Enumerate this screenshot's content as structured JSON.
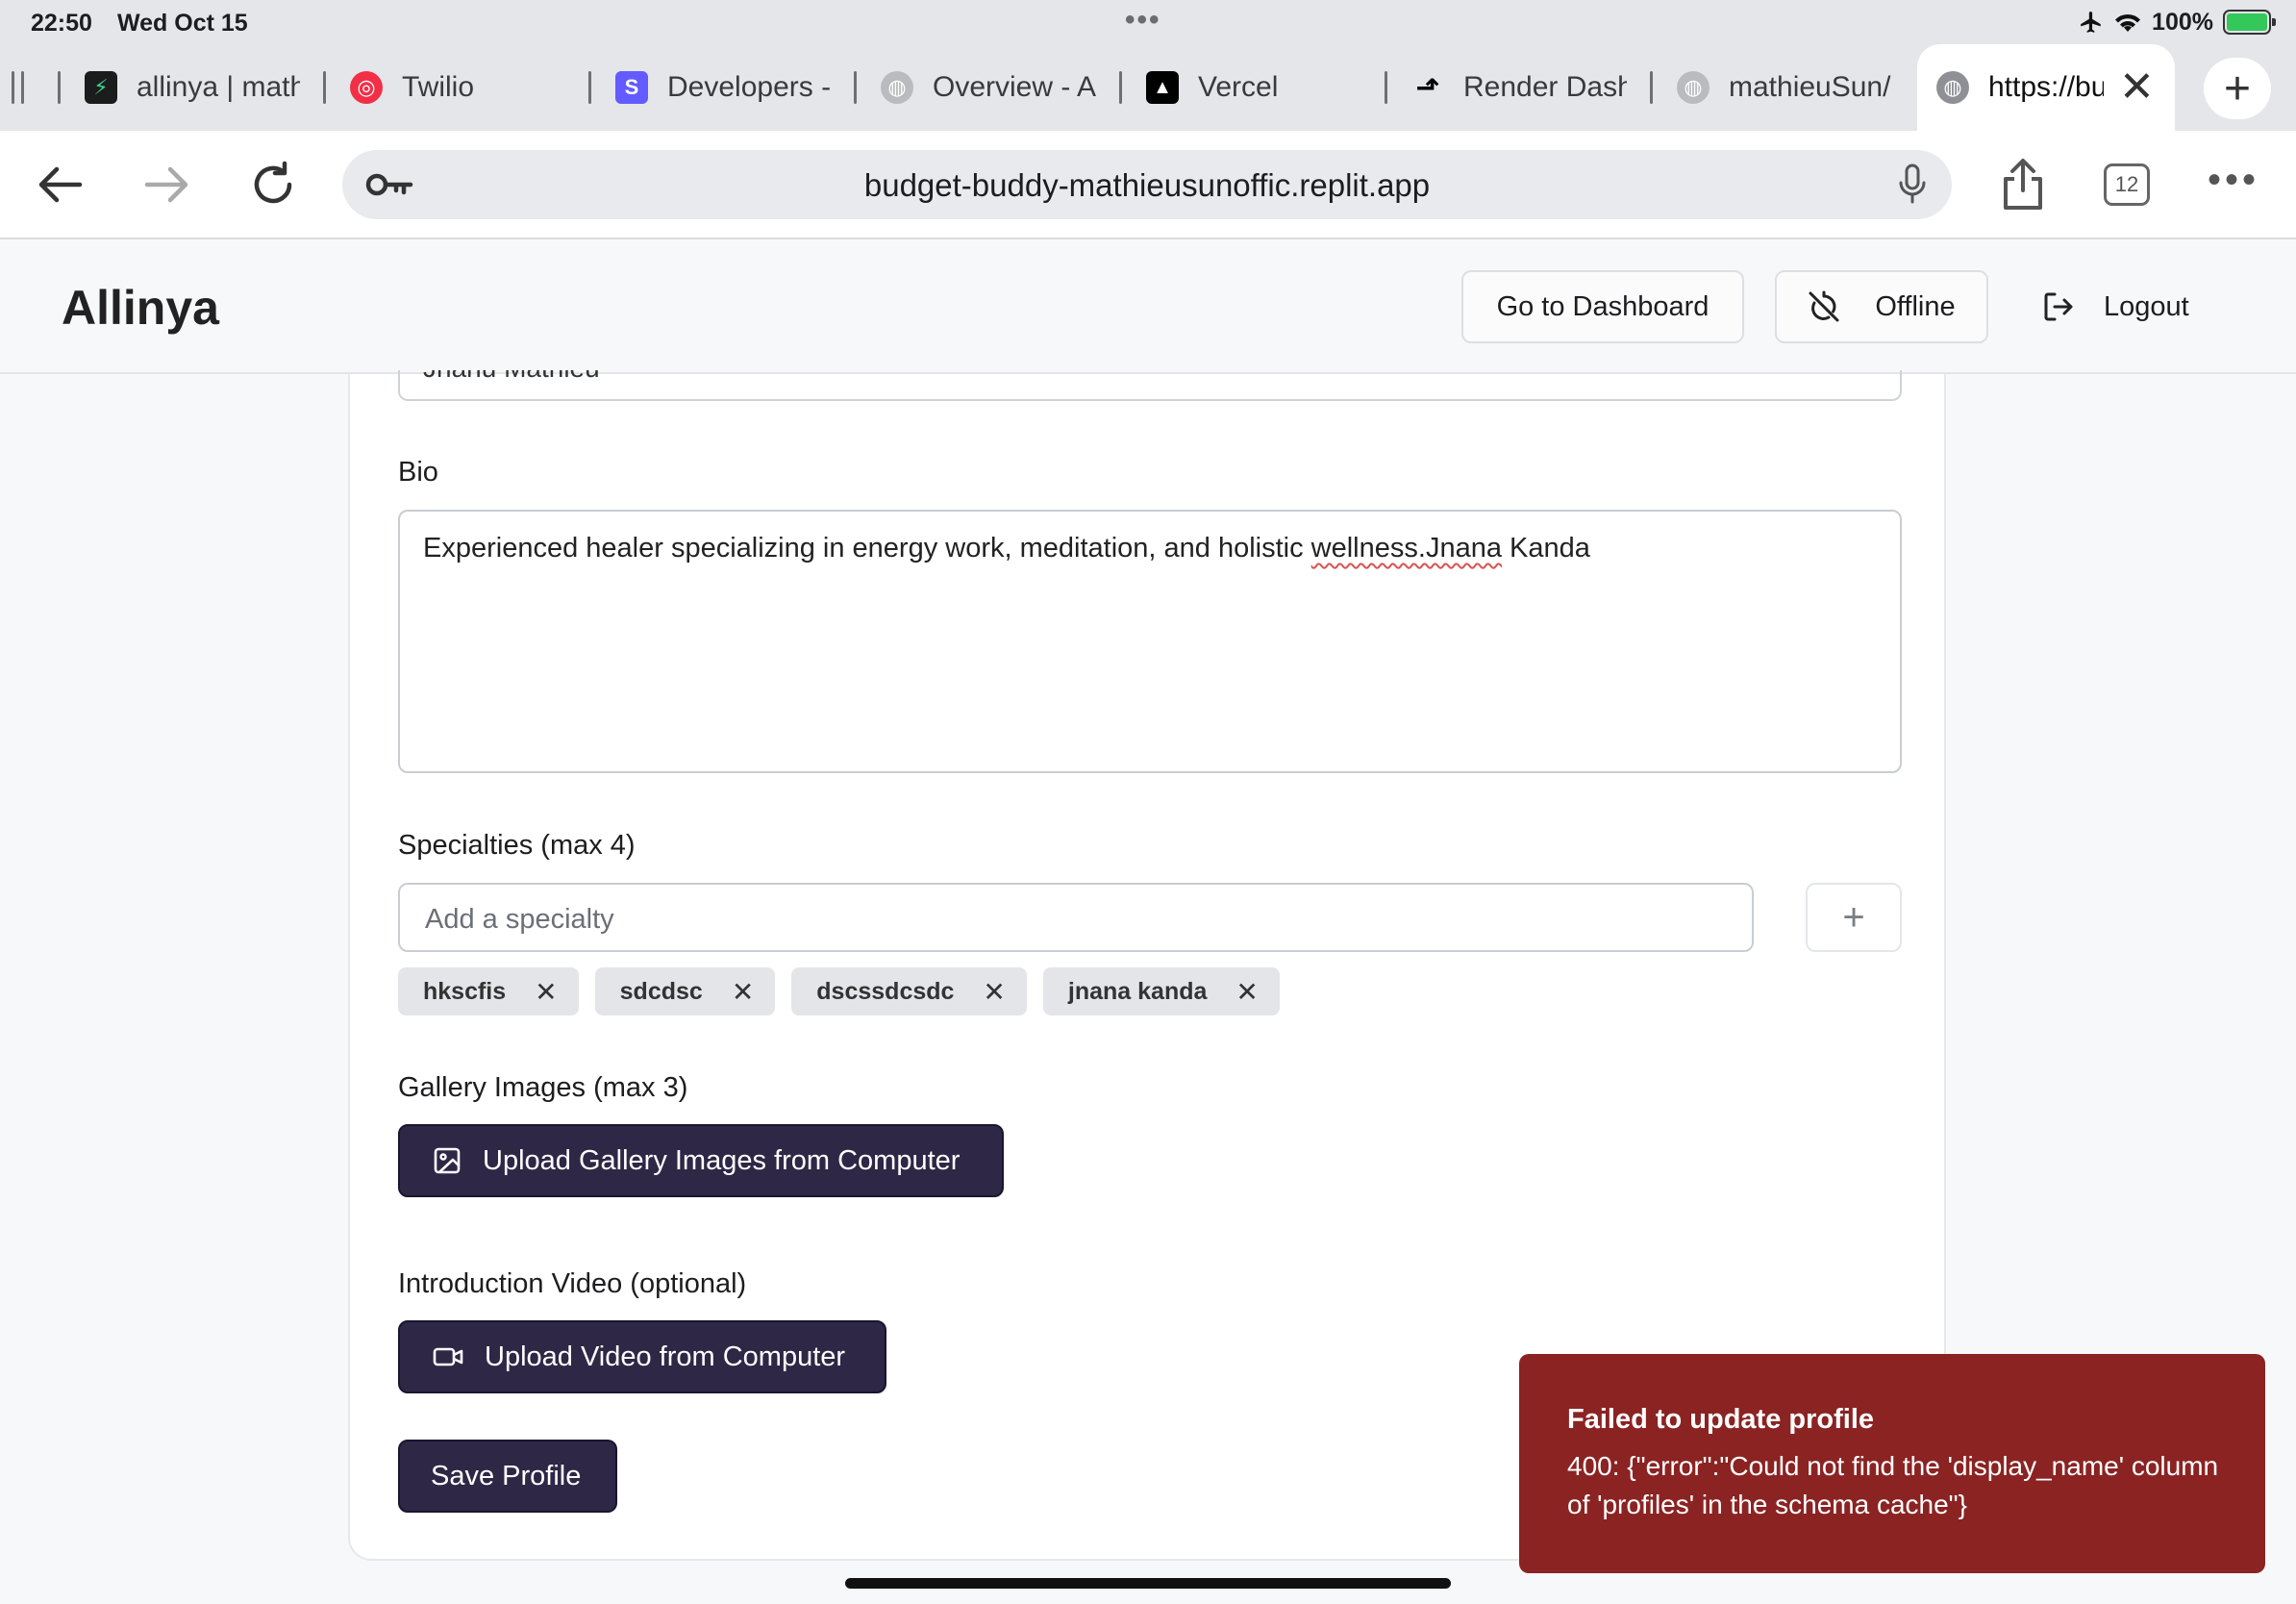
{
  "status_bar": {
    "time": "22:50",
    "date": "Wed Oct 15",
    "battery": "100%"
  },
  "browser": {
    "tabs": [
      {
        "label": "allinya | math",
        "icon": "supabase-icon"
      },
      {
        "label": "Twilio",
        "icon": "twilio-icon"
      },
      {
        "label": "Developers -",
        "icon": "stripe-icon"
      },
      {
        "label": "Overview - A",
        "icon": "globe-icon"
      },
      {
        "label": "Vercel",
        "icon": "vercel-icon"
      },
      {
        "label": "Render Dash",
        "icon": "render-icon"
      },
      {
        "label": "mathieuSun/",
        "icon": "globe-icon"
      },
      {
        "label": "https://bu",
        "icon": "globe-icon",
        "active": true
      }
    ],
    "url": "budget-buddy-mathieusunoffic.replit.app",
    "tab_count": "12"
  },
  "header": {
    "brand": "Allinya",
    "dashboard_button": "Go to Dashboard",
    "offline_button": "Offline",
    "logout_button": "Logout"
  },
  "form": {
    "previous_field_value": "Jnanu Mathieu",
    "bio_label": "Bio",
    "bio_value_prefix": "Experienced healer specializing in energy work, meditation, and holistic ",
    "bio_value_misspelled": "wellness.Jnana",
    "bio_value_suffix": " Kanda",
    "specialties_label": "Specialties (max 4)",
    "specialty_placeholder": "Add a specialty",
    "add_specialty_symbol": "+",
    "specialties": [
      "hkscfis",
      "sdcdsc",
      "dscssdcsdc",
      "jnana kanda"
    ],
    "gallery_label": "Gallery Images (max 3)",
    "gallery_button": "Upload Gallery Images from Computer",
    "video_label": "Introduction Video (optional)",
    "video_button": "Upload Video from Computer",
    "save_button": "Save Profile"
  },
  "toast": {
    "title": "Failed to update profile",
    "message": "400: {\"error\":\"Could not find the 'display_name' column of 'profiles' in the schema cache\"}"
  },
  "colors": {
    "primary_button": "#2e2745",
    "toast_error": "#8b2323",
    "chip_bg": "#e4e5e8"
  }
}
